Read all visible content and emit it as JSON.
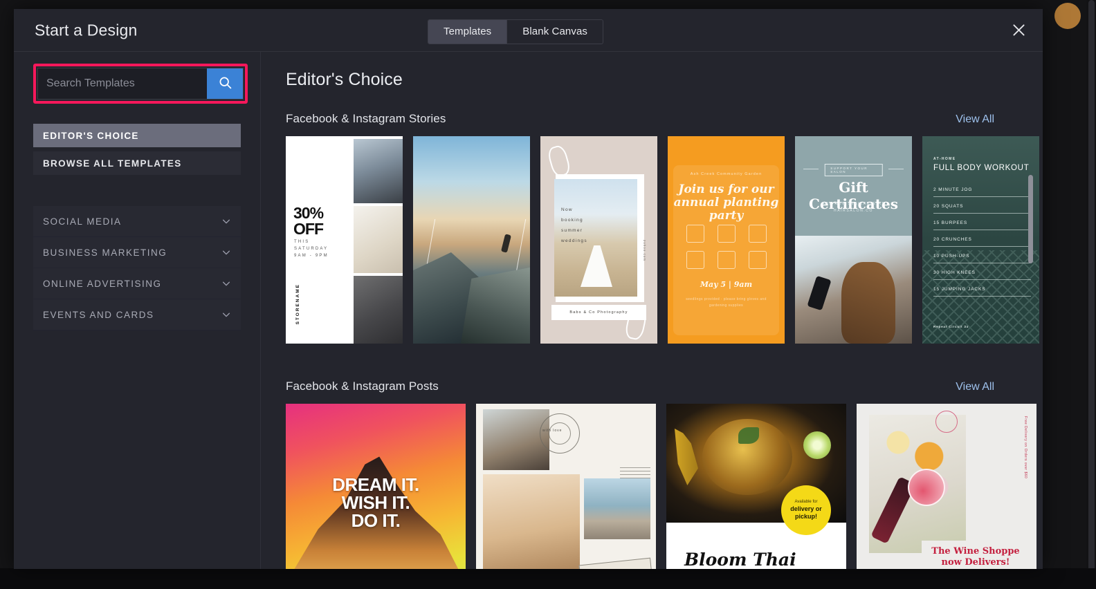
{
  "modal": {
    "title": "Start a Design",
    "close_icon": "close-icon",
    "tabs": [
      {
        "label": "Templates",
        "active": true
      },
      {
        "label": "Blank Canvas",
        "active": false
      }
    ]
  },
  "sidebar": {
    "search": {
      "placeholder": "Search Templates",
      "value": "",
      "button_icon": "search-icon",
      "button_color": "#3b82d6",
      "highlight_color": "#f5185b"
    },
    "primary_items": [
      {
        "label": "EDITOR'S CHOICE",
        "active": true
      },
      {
        "label": "BROWSE ALL TEMPLATES",
        "active": false
      }
    ],
    "category_groups": [
      {
        "label": "SOCIAL MEDIA",
        "expanded": false,
        "chevron": "chevron-down-icon"
      },
      {
        "label": "BUSINESS MARKETING",
        "expanded": false,
        "chevron": "chevron-down-icon"
      },
      {
        "label": "ONLINE ADVERTISING",
        "expanded": false,
        "chevron": "chevron-down-icon"
      },
      {
        "label": "EVENTS AND CARDS",
        "expanded": false,
        "chevron": "chevron-down-icon"
      }
    ]
  },
  "content": {
    "heading": "Editor's Choice",
    "sections": [
      {
        "title": "Facebook & Instagram Stories",
        "view_all": "View All",
        "templates": [
          {
            "name": "30-percent-off-sale-story",
            "headline": "30%\nOFF",
            "sub": "THIS\nSATURDAY\n9AM - 9PM",
            "brand": "STORENAME"
          },
          {
            "name": "cliff-handstand-story",
            "headline": ""
          },
          {
            "name": "summer-weddings-photography-story",
            "headline": "Now\nbooking\nsummer\nweddings",
            "brand": "Babs & Co Photography",
            "url": "zohoo.com"
          },
          {
            "name": "planting-party-story",
            "kicker": "Ash Creek Community Garden",
            "headline": "Join us for our annual planting party",
            "date": "May 5 | 9am",
            "note": "seedlings provided · please bring gloves and gardening supplies"
          },
          {
            "name": "gift-certificates-salon-story",
            "kicker": "SUPPORT YOUR SALON",
            "headline": "Gift Certificates",
            "sub": "ARE NOW AVAILABLE AT\nHAIRSALON.CO"
          },
          {
            "name": "full-body-workout-story",
            "kicker": "AT-HOME",
            "headline": "FULL BODY WORKOUT",
            "items": [
              "2 MINUTE JOG",
              "20 SQUATS",
              "15 BURPEES",
              "20 CRUNCHES",
              "10 PUSH-UPS",
              "30 HIGH KNEES",
              "15 JUMPING JACKS"
            ],
            "footer": "Repeat Circuit 3x"
          }
        ]
      },
      {
        "title": "Facebook & Instagram Posts",
        "view_all": "View All",
        "templates": [
          {
            "name": "dream-it-wish-it-do-it-post",
            "headline": "DREAM IT.\nWISH IT.\nDO IT."
          },
          {
            "name": "travel-collage-post",
            "headline": "with love"
          },
          {
            "name": "bloom-thai-delivery-post",
            "headline": "Bloom Thai",
            "badge_line1": "Available for",
            "badge_line2": "delivery or pickup!",
            "badge_color": "#f4d917"
          },
          {
            "name": "wine-shoppe-delivery-post",
            "headline": "The Wine Shoppe\nnow Delivers!",
            "vertical_note": "Free Delivery on Orders over $60"
          }
        ]
      }
    ]
  }
}
